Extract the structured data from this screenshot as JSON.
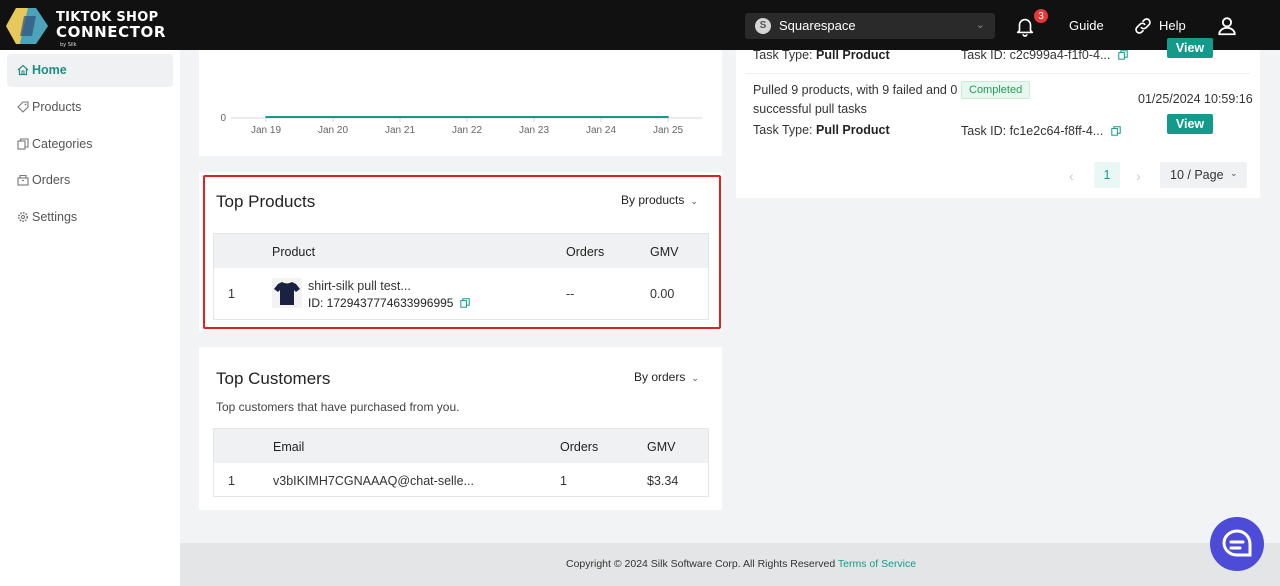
{
  "header": {
    "logo_line1": "TIKTOK SHOP",
    "logo_line2": "CONNECTOR",
    "logo_by": "by Silk",
    "store": {
      "initial": "S",
      "name": "Squarespace"
    },
    "notifications_count": "3",
    "guide_label": "Guide",
    "help_label": "Help"
  },
  "sidebar": {
    "items": [
      {
        "label": "Home",
        "icon": "home-icon",
        "active": true
      },
      {
        "label": "Products",
        "icon": "tag-icon"
      },
      {
        "label": "Categories",
        "icon": "copy-icon"
      },
      {
        "label": "Orders",
        "icon": "box-icon"
      },
      {
        "label": "Settings",
        "icon": "gear-icon"
      }
    ]
  },
  "chart_data": {
    "type": "line",
    "x": [
      "Jan 19",
      "Jan 20",
      "Jan 21",
      "Jan 22",
      "Jan 23",
      "Jan 24",
      "Jan 25"
    ],
    "series": [
      {
        "values": [
          0,
          0,
          0,
          0,
          0,
          0,
          0
        ]
      }
    ],
    "yticks": [
      "0"
    ],
    "title": "",
    "xlabel": "",
    "ylabel": "",
    "color": "#139a8a"
  },
  "top_products": {
    "title": "Top Products",
    "sort_label": "By products",
    "columns": {
      "product": "Product",
      "orders": "Orders",
      "gmv": "GMV"
    },
    "rows": [
      {
        "rank": "1",
        "name": "shirt-silk pull test...",
        "id": "ID: 1729437774633996995",
        "orders": "--",
        "gmv": "0.00"
      }
    ]
  },
  "top_customers": {
    "title": "Top Customers",
    "sort_label": "By orders",
    "subtitle": "Top customers that have purchased from you.",
    "columns": {
      "email": "Email",
      "orders": "Orders",
      "gmv": "GMV"
    },
    "rows": [
      {
        "rank": "1",
        "email": "v3bIKIMH7CGNAAAQ@chat-selle...",
        "orders": "1",
        "gmv": "$3.34"
      }
    ]
  },
  "tasks": {
    "task_type_label": "Task Type: ",
    "items": [
      {
        "type": "Pull Product",
        "task_id": "Task ID: c2c999a4-f1f0-4...",
        "view_label": "View"
      },
      {
        "description_line1": "Pulled 9 products, with 9 failed and 0",
        "description_line2": "successful pull tasks",
        "status": "Completed",
        "time": "01/25/2024 10:59:16",
        "type": "Pull Product",
        "task_id": "Task ID: fc1e2c64-f8ff-4...",
        "view_label": "View"
      }
    ],
    "pagination": {
      "current_page": "1",
      "page_size": "10  / Page"
    }
  },
  "footer": {
    "copyright": "Copyright © 2024 Silk Software Corp. All Rights Reserved ",
    "terms_link": "Terms of Service"
  },
  "colors": {
    "accent": "#139a8a",
    "highlight": "#e31f1f",
    "badge": "#e5383b",
    "chat": "#4c4cd8"
  }
}
